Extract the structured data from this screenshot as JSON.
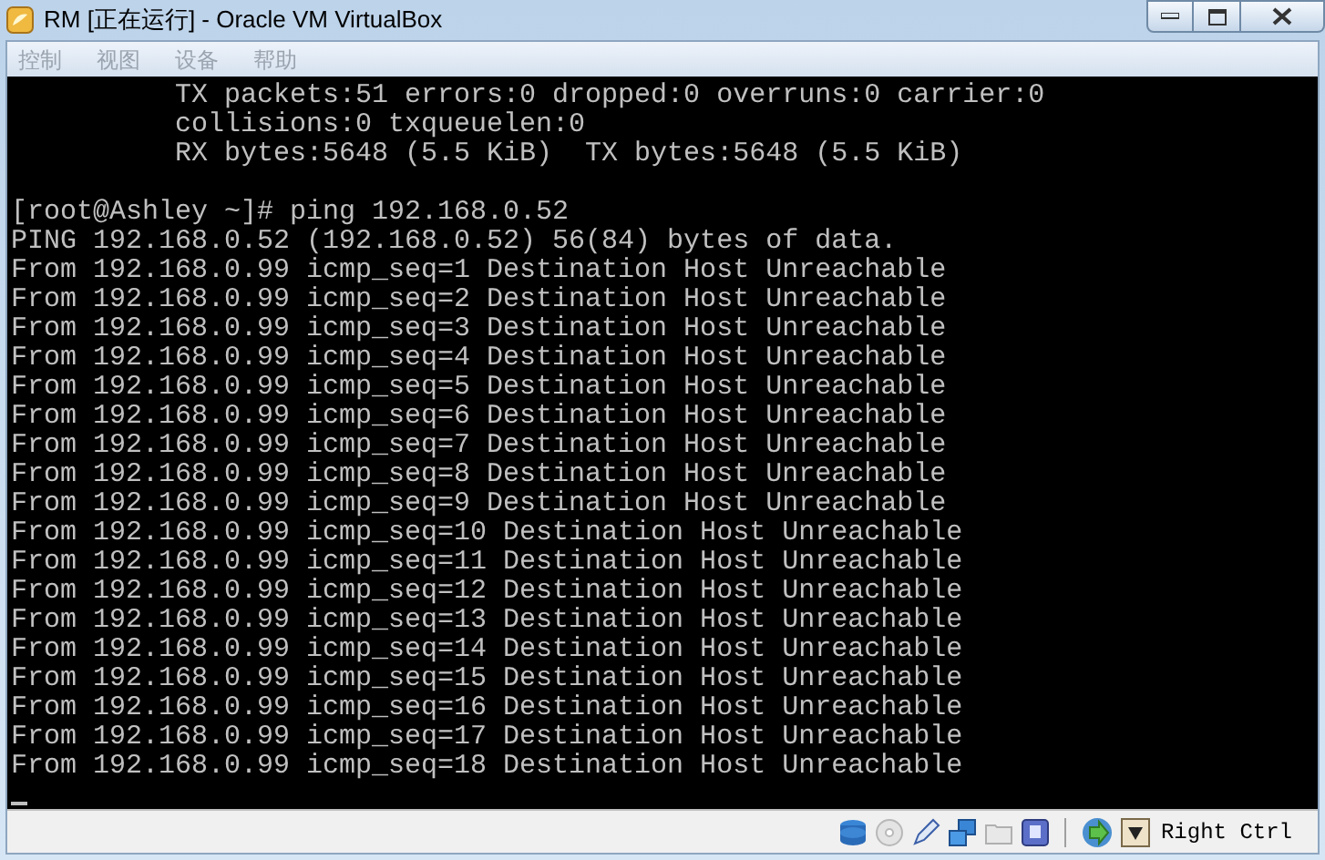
{
  "window": {
    "title": "RM [正在运行] - Oracle VM VirtualBox"
  },
  "menu": [
    {
      "label": "控制",
      "disabled": true
    },
    {
      "label": "视图",
      "disabled": true
    },
    {
      "label": "设备",
      "disabled": true
    },
    {
      "label": "帮助",
      "disabled": true
    }
  ],
  "terminal": {
    "blocks": [
      [
        "          TX packets:51 errors:0 dropped:0 overruns:0 carrier:0",
        "          collisions:0 txqueuelen:0",
        "          RX bytes:5648 (5.5 KiB)  TX bytes:5648 (5.5 KiB)"
      ],
      [
        "[root@Ashley ~]# ping 192.168.0.52",
        "PING 192.168.0.52 (192.168.0.52) 56(84) bytes of data.",
        "From 192.168.0.99 icmp_seq=1 Destination Host Unreachable",
        "From 192.168.0.99 icmp_seq=2 Destination Host Unreachable",
        "From 192.168.0.99 icmp_seq=3 Destination Host Unreachable",
        "From 192.168.0.99 icmp_seq=4 Destination Host Unreachable",
        "From 192.168.0.99 icmp_seq=5 Destination Host Unreachable",
        "From 192.168.0.99 icmp_seq=6 Destination Host Unreachable",
        "From 192.168.0.99 icmp_seq=7 Destination Host Unreachable",
        "From 192.168.0.99 icmp_seq=8 Destination Host Unreachable",
        "From 192.168.0.99 icmp_seq=9 Destination Host Unreachable",
        "From 192.168.0.99 icmp_seq=10 Destination Host Unreachable",
        "From 192.168.0.99 icmp_seq=11 Destination Host Unreachable",
        "From 192.168.0.99 icmp_seq=12 Destination Host Unreachable",
        "From 192.168.0.99 icmp_seq=13 Destination Host Unreachable",
        "From 192.168.0.99 icmp_seq=14 Destination Host Unreachable",
        "From 192.168.0.99 icmp_seq=15 Destination Host Unreachable",
        "From 192.168.0.99 icmp_seq=16 Destination Host Unreachable",
        "From 192.168.0.99 icmp_seq=17 Destination Host Unreachable",
        "From 192.168.0.99 icmp_seq=18 Destination Host Unreachable"
      ]
    ]
  },
  "status_bar": {
    "host_key": "Right Ctrl"
  }
}
